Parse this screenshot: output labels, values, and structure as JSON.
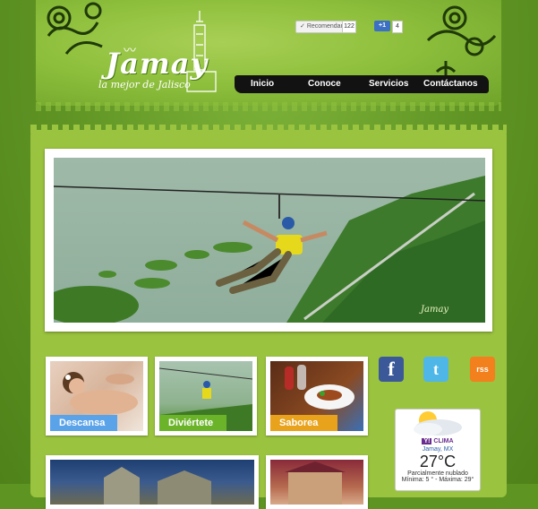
{
  "brand": {
    "title": "Jamay",
    "subtitle": "la mejor de Jalisco"
  },
  "share": {
    "recommend_label": "Recomendar",
    "recommend_count": "122",
    "plus_label": "+1",
    "plus_count": "4"
  },
  "nav": {
    "items": [
      {
        "label": "Inicio"
      },
      {
        "label": "Conoce"
      },
      {
        "label": "Servicios"
      },
      {
        "label": "Contáctanos"
      }
    ]
  },
  "tiles": [
    {
      "label": "Descansa",
      "color": "#5aa3e8"
    },
    {
      "label": "Diviértete",
      "color": "#6bb42a"
    },
    {
      "label": "Saborea",
      "color": "#e8a21c"
    }
  ],
  "social": {
    "facebook": "f",
    "twitter": "t",
    "rss": "rss"
  },
  "weather": {
    "provider": "CLIMA",
    "location": "Jamay, MX",
    "temperature": "27°C",
    "condition": "Parcialmente nublado",
    "range": "Mínima: 5 ° - Máxima: 29°"
  },
  "colors": {
    "accent_green": "#8fc03d",
    "nav_bg": "#121212"
  }
}
